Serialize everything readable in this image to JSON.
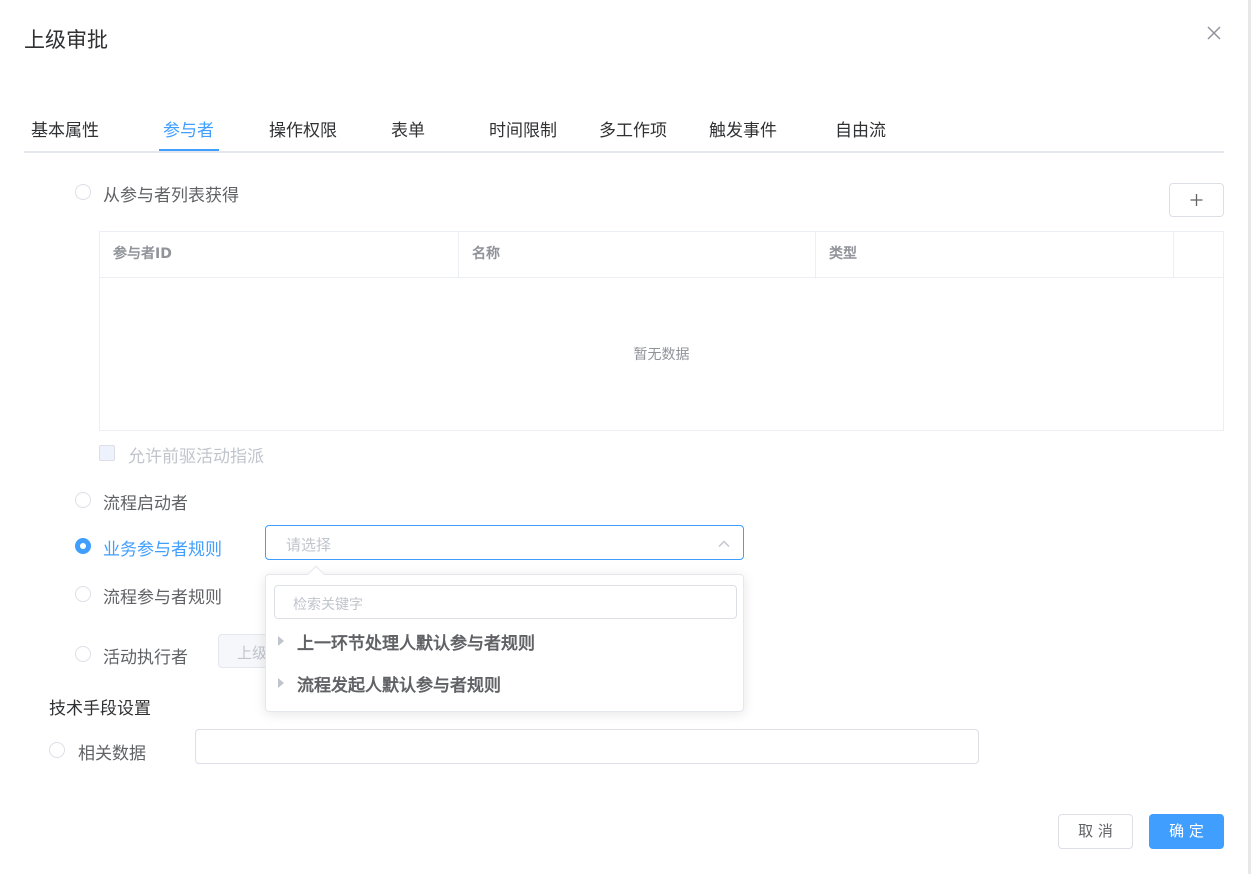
{
  "dialog": {
    "title": "上级审批",
    "close_icon": "close-icon"
  },
  "tabs": [
    {
      "label": "基本属性",
      "active": false
    },
    {
      "label": "参与者",
      "active": true
    },
    {
      "label": "操作权限",
      "active": false
    },
    {
      "label": "表单",
      "active": false
    },
    {
      "label": "时间限制",
      "active": false
    },
    {
      "label": "多工作项",
      "active": false
    },
    {
      "label": "触发事件",
      "active": false
    },
    {
      "label": "自由流",
      "active": false
    }
  ],
  "participants": {
    "option_list": {
      "label": "从参与者列表获得",
      "checked": false
    },
    "add_button_symbol": "+",
    "table": {
      "columns": [
        "参与者ID",
        "名称",
        "类型",
        ""
      ],
      "empty_text": "暂无数据"
    },
    "allow_predecessor": {
      "label": "允许前驱活动指派",
      "disabled": true
    },
    "option_starter": {
      "label": "流程启动者",
      "checked": false
    },
    "option_business_rule": {
      "label": "业务参与者规则",
      "checked": true
    },
    "business_rule_select": {
      "placeholder": "请选择"
    },
    "option_process_rule": {
      "label": "流程参与者规则",
      "checked": false
    },
    "option_activity_executor": {
      "label": "活动执行者",
      "checked": false
    },
    "activity_executor_input": {
      "value": "上级"
    },
    "dropdown": {
      "search_placeholder": "检索关键字",
      "items": [
        "上一环节处理人默认参与者规则",
        "流程发起人默认参与者规则"
      ]
    }
  },
  "tech": {
    "section_title": "技术手段设置",
    "option_related_data": {
      "label": "相关数据",
      "checked": false
    },
    "related_data_value": ""
  },
  "footer": {
    "cancel_label": "取 消",
    "ok_label": "确 定"
  },
  "colors": {
    "accent": "#409eff",
    "text": "#606266",
    "border": "#dcdfe6"
  }
}
